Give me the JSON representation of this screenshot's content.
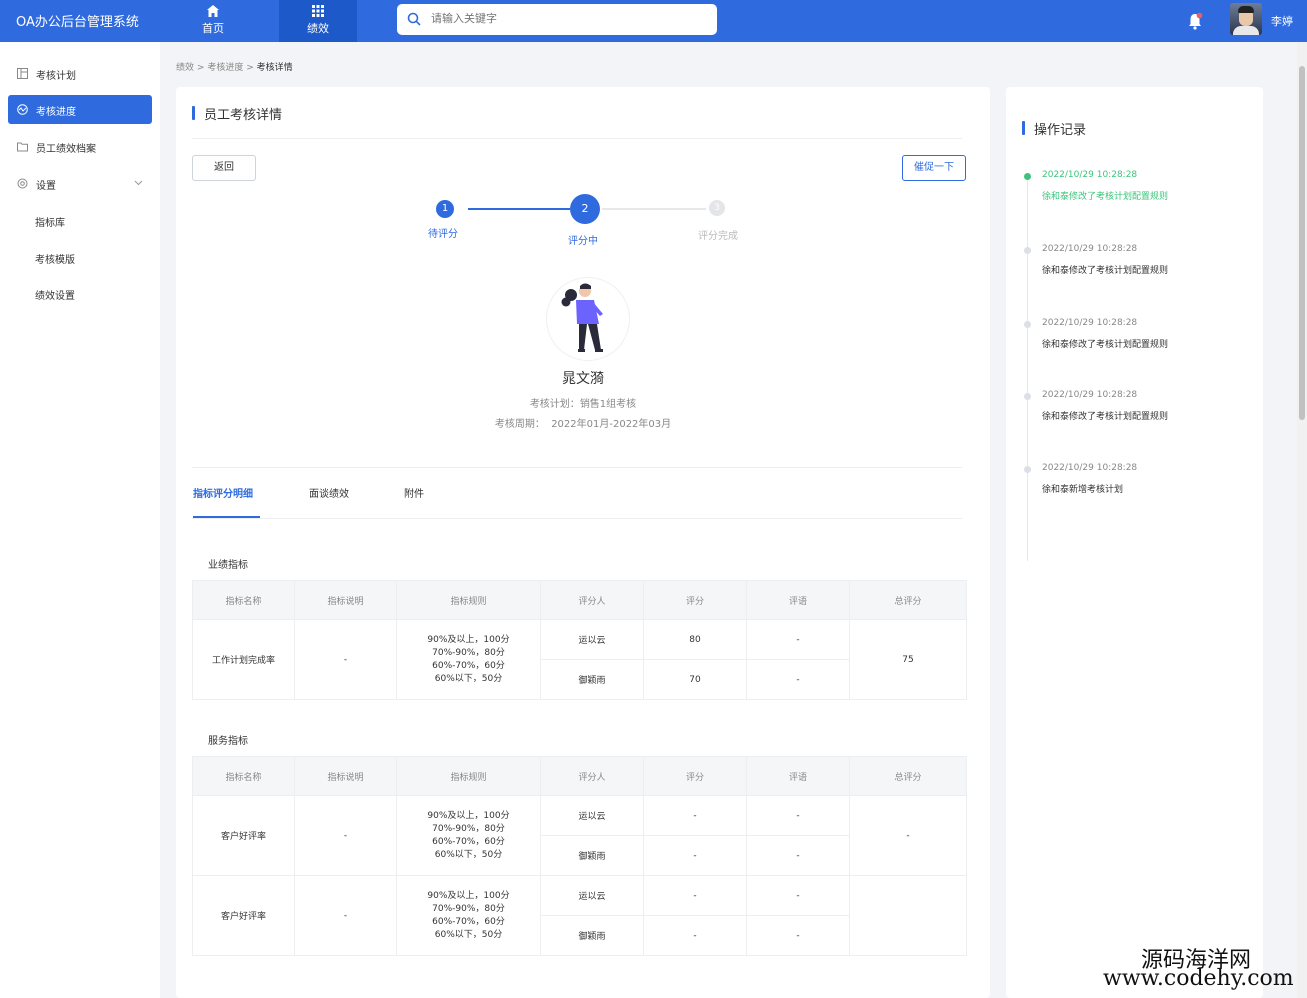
{
  "app": {
    "title": "OA办公后台管理系统"
  },
  "topnav": {
    "tabs": [
      {
        "label": "首页",
        "icon": "home-icon"
      },
      {
        "label": "绩效",
        "icon": "grid-icon"
      }
    ],
    "active": 1
  },
  "search": {
    "placeholder": "请输入关键字"
  },
  "user": {
    "name": "李婷"
  },
  "colors": {
    "primary": "#2f6bde",
    "success": "#3cc47c"
  },
  "sidebar": {
    "items": [
      {
        "label": "考核计划",
        "icon": "plan-icon"
      },
      {
        "label": "考核进度",
        "icon": "progress-icon"
      },
      {
        "label": "员工绩效档案",
        "icon": "folder-icon"
      },
      {
        "label": "设置",
        "icon": "settings-icon"
      }
    ],
    "sub_items": [
      "指标库",
      "考核模版",
      "绩效设置"
    ]
  },
  "breadcrumb": {
    "items": [
      "绩效",
      "考核进度",
      "考核详情"
    ],
    "separator": ">"
  },
  "detail": {
    "title": "员工考核详情",
    "back_label": "返回",
    "urge_label": "催促一下",
    "steps": [
      {
        "num": "1",
        "label": "待评分"
      },
      {
        "num": "2",
        "label": "评分中"
      },
      {
        "num": "3",
        "label": "评分完成"
      }
    ],
    "current_step": 2,
    "employee": {
      "name": "晁文漪",
      "plan_label": "考核计划：",
      "plan": "销售1组考核",
      "period_label": "考核周期：",
      "period": "2022年01月-2022年03月"
    },
    "tabs": [
      "指标评分明细",
      "面谈绩效",
      "附件"
    ],
    "active_tab": 0
  },
  "table_headers": [
    "指标名称",
    "指标说明",
    "指标规则",
    "评分人",
    "评分",
    "评语",
    "总评分"
  ],
  "sections": [
    {
      "title": "业绩指标",
      "rows": [
        {
          "name": "工作计划完成率",
          "desc": "-",
          "rule": "90%及以上，100分\n70%-90%，80分\n60%-70%，60分\n60%以下，50分",
          "raters": [
            {
              "rater": "运以云",
              "score": "80",
              "comment": "-"
            },
            {
              "rater": "御颖雨",
              "score": "70",
              "comment": "-"
            }
          ],
          "total": "75"
        }
      ]
    },
    {
      "title": "服务指标",
      "rows": [
        {
          "name": "客户好评率",
          "desc": "-",
          "rule": "90%及以上，100分\n70%-90%，80分\n60%-70%，60分\n60%以下，50分",
          "raters": [
            {
              "rater": "运以云",
              "score": "-",
              "comment": "-"
            },
            {
              "rater": "御颖雨",
              "score": "-",
              "comment": "-"
            }
          ],
          "total": "-"
        },
        {
          "name": "客户好评率",
          "desc": "-",
          "rule": "90%及以上，100分\n70%-90%，80分\n60%-70%，60分\n60%以下，50分",
          "raters": [
            {
              "rater": "运以云",
              "score": "-",
              "comment": "-"
            },
            {
              "rater": "御颖雨",
              "score": "-",
              "comment": "-"
            }
          ],
          "total": ""
        }
      ]
    }
  ],
  "log": {
    "title": "操作记录",
    "entries": [
      {
        "time": "2022/10/29 10:28:28",
        "text": "徐和泰修改了考核计划配置规则"
      },
      {
        "time": "2022/10/29 10:28:28",
        "text": "徐和泰修改了考核计划配置规则"
      },
      {
        "time": "2022/10/29 10:28:28",
        "text": "徐和泰修改了考核计划配置规则"
      },
      {
        "time": "2022/10/29 10:28:28",
        "text": "徐和泰修改了考核计划配置规则"
      },
      {
        "time": "2022/10/29 10:28:28",
        "text": "徐和泰新增考核计划"
      }
    ]
  },
  "watermark": {
    "line1": "源码海洋网",
    "line2": "www.codehy.com"
  }
}
